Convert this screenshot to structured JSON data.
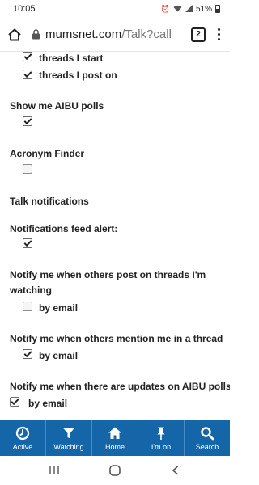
{
  "status_bar": {
    "time": "10:05",
    "battery": "51%"
  },
  "browser": {
    "url_host": "mumsnet.com",
    "url_path": "/Talk?call",
    "tab_count": "2"
  },
  "settings": {
    "threads_i_start": "threads I start",
    "threads_i_post_on": "threads I post on",
    "show_aibu_polls": "Show me AIBU polls",
    "acronym_finder": "Acronym Finder",
    "talk_notifications": "Talk notifications",
    "notifications_feed_alert": "Notifications feed alert:",
    "notify_watching": "Notify me when others post on threads I'm watching",
    "notify_mention": "Notify me when others mention me in a thread",
    "notify_aibu": "Notify me when there are updates on AIBU polls:",
    "by_email": "by email"
  },
  "checkboxes": {
    "threads_i_start": true,
    "threads_i_post_on": true,
    "show_aibu_polls": true,
    "acronym_finder": false,
    "notifications_feed_alert": true,
    "watching_by_email": false,
    "mention_by_email": true,
    "aibu_by_email": true
  },
  "bottom_nav": {
    "items": [
      {
        "label": "Active",
        "icon": "clock-icon"
      },
      {
        "label": "Watching",
        "icon": "filter-icon"
      },
      {
        "label": "Home",
        "icon": "home-icon"
      },
      {
        "label": "I'm on",
        "icon": "pin-icon"
      },
      {
        "label": "Search",
        "icon": "search-icon"
      }
    ]
  },
  "colors": {
    "nav_bg": "#1566a8"
  }
}
